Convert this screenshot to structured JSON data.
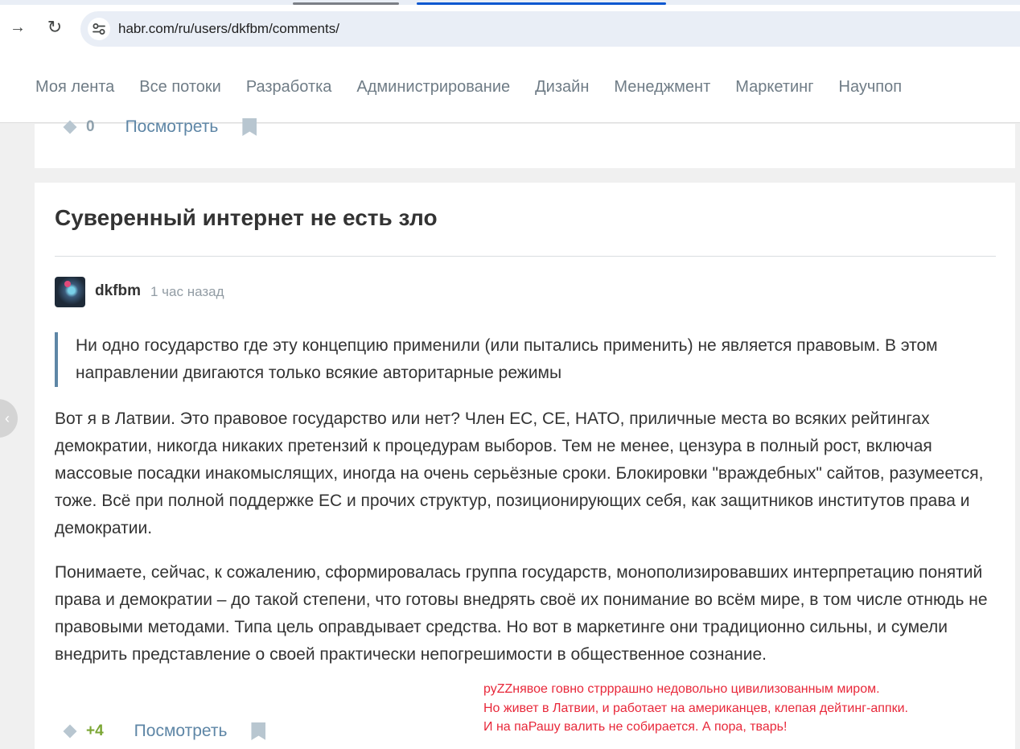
{
  "browser": {
    "url": "habr.com/ru/users/dkfbm/comments/",
    "forward_icon": "→",
    "reload_icon": "↻"
  },
  "topnav": {
    "items": [
      "Моя лента",
      "Все потоки",
      "Разработка",
      "Администрирование",
      "Дизайн",
      "Менеджмент",
      "Маркетинг",
      "Научпоп"
    ]
  },
  "prev_comment": {
    "score": "0",
    "view_label": "Посмотреть"
  },
  "post": {
    "title": "Суверенный интернет не есть зло",
    "comment": {
      "author": "dkfbm",
      "time": "1 час назад",
      "quote": "Ни одно государство где эту концепцию применили (или пытались применить) не является правовым. В этом направлении двигаются только всякие авторитарные режимы",
      "paragraphs": [
        "Вот я в Латвии. Это правовое государство или нет? Член ЕС, СЕ, НАТО, приличные места во всяких рейтингах демократии, никогда никаких претензий к процедурам выборов. Тем не менее, цензура в полный рост, включая массовые посадки инакомыслящих, иногда на очень серьёзные сроки. Блокировки \"враждебных\" сайтов, разумеется, тоже. Всё при полной поддержке ЕС и прочих структур, позиционирующих себя, как защитников институтов права и демократии.",
        "Понимаете, сейчас, к сожалению, сформировалась группа государств, монополизировавших интерпретацию понятий права и демократии – до такой степени, что готовы внедрять своё их понимание во всём мире, в том числе отнюдь не правовыми методами. Типа цель оправдывает средства. Но вот в маркетинге они традиционно сильны, и сумели внедрить представление о своей практически непогрешимости в общественное сознание."
      ],
      "score": "+4",
      "view_label": "Посмотреть"
    }
  },
  "annotation": {
    "lines": [
      "руZZнявое говно стрррашно недовольно цивилизованным миром.",
      "Но живет в Латвии, и работает на американцев, клепая дейтинг-аппки.",
      "И на паРашу валить не собирается. А пора, тварь!"
    ],
    "color": "#e8283a"
  },
  "colors": {
    "accent": "#5e86a6",
    "positive": "#7ba634",
    "nav_text": "#6f7c86"
  }
}
